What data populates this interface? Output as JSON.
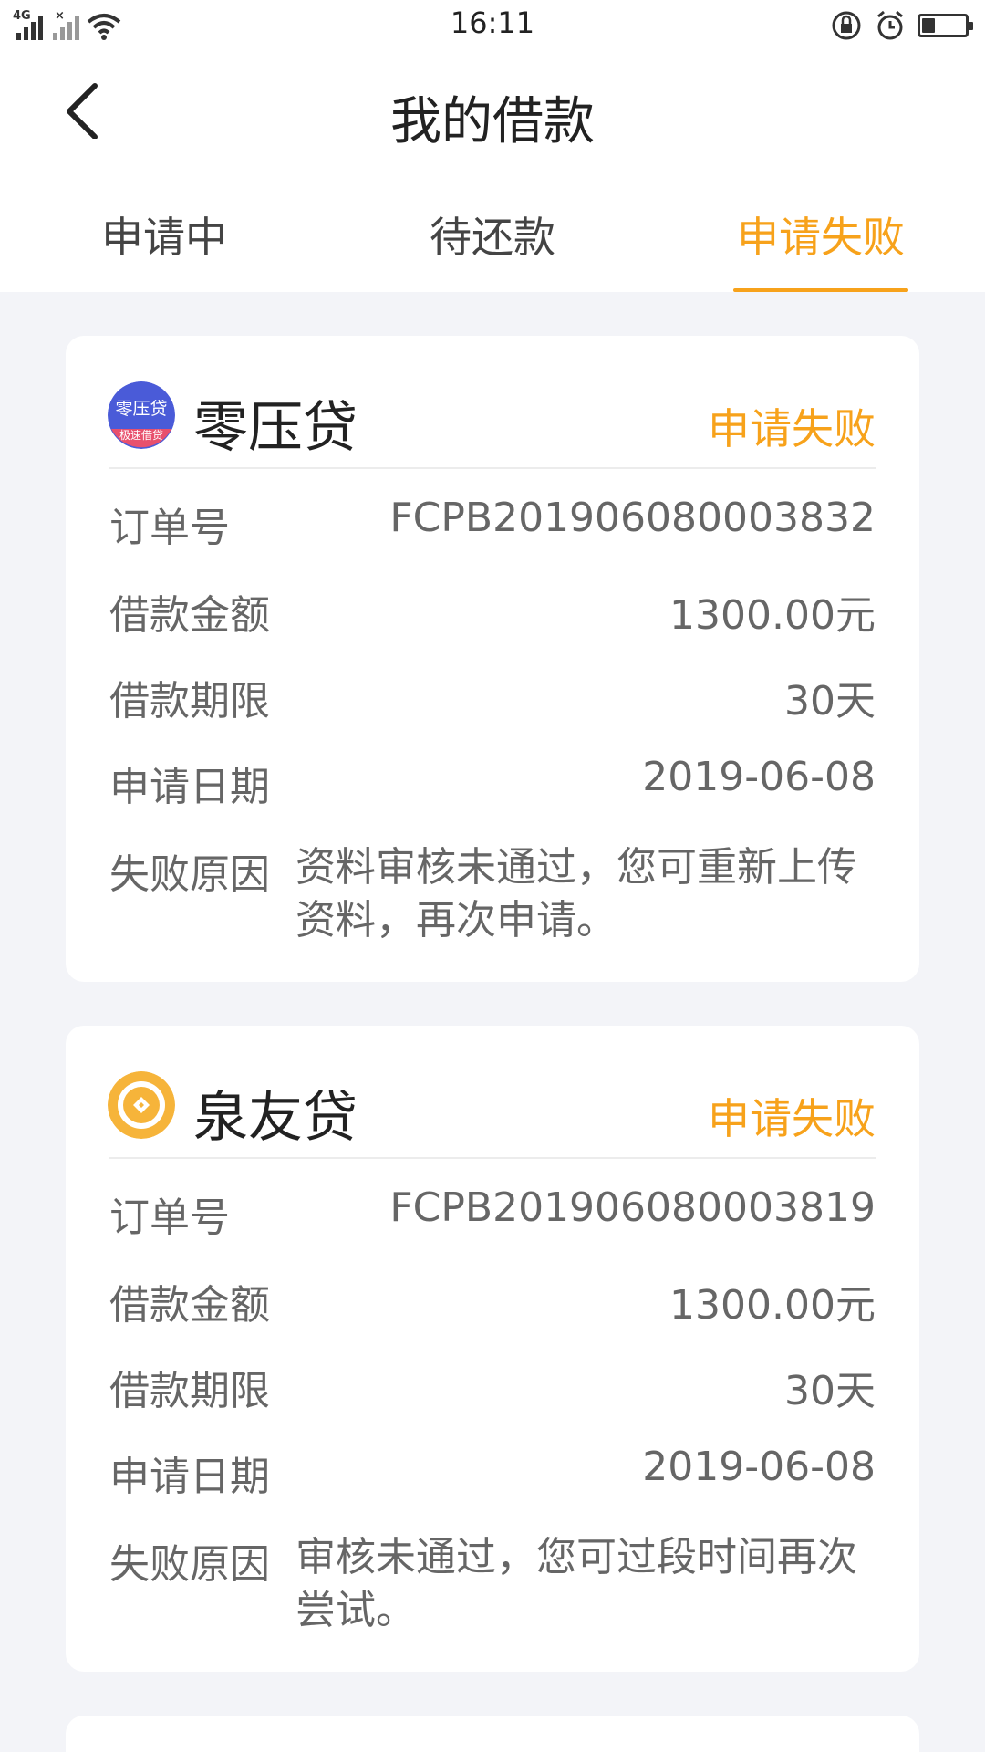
{
  "status_bar": {
    "time": "16:11",
    "network": "4G",
    "colors": {
      "icon": "#333333"
    }
  },
  "nav": {
    "title": "我的借款",
    "back_icon": "chevron-left-icon"
  },
  "tabs": [
    {
      "label": "申请中",
      "active": false
    },
    {
      "label": "待还款",
      "active": false
    },
    {
      "label": "申请失败",
      "active": true
    }
  ],
  "theme": {
    "accent": "#f7a21b",
    "background": "#f3f4f8"
  },
  "cards": [
    {
      "brand": "零压贷",
      "logo_text_top": "零压贷",
      "logo_text_bottom": "极速借贷",
      "status": "申请失败",
      "fields": [
        {
          "label": "订单号",
          "value": "FCPB201906080003832"
        },
        {
          "label": "借款金额",
          "value": "1300.00元"
        },
        {
          "label": "借款期限",
          "value": "30天"
        },
        {
          "label": "申请日期",
          "value": "2019-06-08"
        }
      ],
      "reason_label": "失败原因",
      "reason": "资料审核未通过，您可重新上传资料，再次申请。"
    },
    {
      "brand": "泉友贷",
      "status": "申请失败",
      "fields": [
        {
          "label": "订单号",
          "value": "FCPB201906080003819"
        },
        {
          "label": "借款金额",
          "value": "1300.00元"
        },
        {
          "label": "借款期限",
          "value": "30天"
        },
        {
          "label": "申请日期",
          "value": "2019-06-08"
        }
      ],
      "reason_label": "失败原因",
      "reason": "审核未通过，您可过段时间再次尝试。"
    }
  ]
}
